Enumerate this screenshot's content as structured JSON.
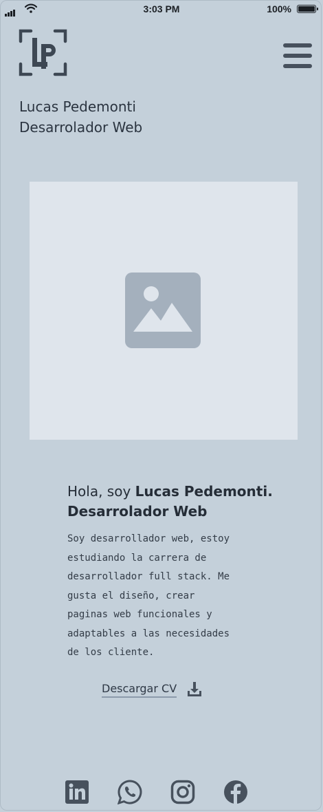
{
  "status_bar": {
    "time": "3:03 PM",
    "battery": "100%"
  },
  "header": {
    "name": "Lucas Pedemonti",
    "role": "Desarrolador Web",
    "logo_text": "LP"
  },
  "intro": {
    "greeting_prefix": "Hola, soy ",
    "greeting_name": "Lucas Pedemonti.",
    "greeting_role": "Desarrolador Web",
    "description": " Soy desarrollador web, estoy\nestudiando la carrera de\ndesarrollador full stack. Me\ngusta el diseño, crear\npaginas web funcionales y\nadaptables a las necesidades\nde los cliente."
  },
  "download": {
    "label": "Descargar CV",
    "icon": "download-icon"
  },
  "social": [
    {
      "name": "linkedin",
      "icon": "linkedin-icon"
    },
    {
      "name": "whatsapp",
      "icon": "whatsapp-icon"
    },
    {
      "name": "instagram",
      "icon": "instagram-icon"
    },
    {
      "name": "facebook",
      "icon": "facebook-icon"
    }
  ],
  "colors": {
    "background": "#c4d0da",
    "placeholder_bg": "#dfe5ec",
    "placeholder_icon": "#a4b0bd",
    "icon_dark": "#47515d"
  }
}
